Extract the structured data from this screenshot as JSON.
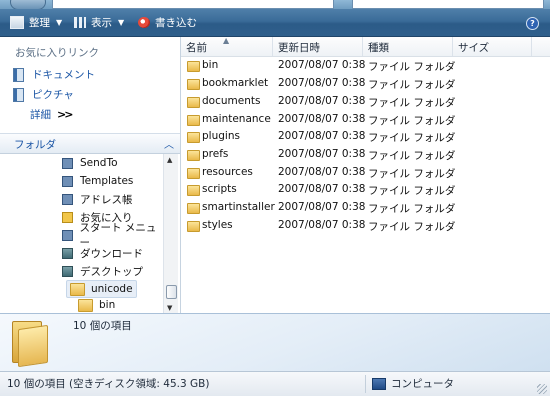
{
  "toolbar": {
    "organize_label": "整理",
    "views_label": "表示",
    "burn_label": "書き込む",
    "help_label": "?"
  },
  "nav": {
    "favorites_title": "お気に入りリンク",
    "favorites": [
      {
        "label": "ドキュメント"
      },
      {
        "label": "ピクチャ"
      }
    ],
    "more_label": "詳細",
    "folders_label": "フォルダ",
    "tree": [
      {
        "label": "SendTo",
        "icon": "shortcut-icon"
      },
      {
        "label": "Templates",
        "icon": "shortcut-icon"
      },
      {
        "label": "アドレス帳",
        "icon": "address-book-icon"
      },
      {
        "label": "お気に入り",
        "icon": "favorites-folder-icon"
      },
      {
        "label": "スタート メニュー",
        "icon": "shortcut-icon"
      },
      {
        "label": "ダウンロード",
        "icon": "downloads-folder-icon"
      },
      {
        "label": "デスクトップ",
        "icon": "desktop-folder-icon"
      },
      {
        "label": "unicode",
        "icon": "folder-icon"
      },
      {
        "label": "bin",
        "icon": "folder-icon"
      }
    ]
  },
  "list": {
    "columns": [
      "名前",
      "更新日時",
      "種類",
      "サイズ"
    ],
    "rows": [
      {
        "name": "bin",
        "date": "2007/08/07 0:38",
        "type": "ファイル フォルダ",
        "size": ""
      },
      {
        "name": "bookmarklet",
        "date": "2007/08/07 0:38",
        "type": "ファイル フォルダ",
        "size": ""
      },
      {
        "name": "documents",
        "date": "2007/08/07 0:38",
        "type": "ファイル フォルダ",
        "size": ""
      },
      {
        "name": "maintenance",
        "date": "2007/08/07 0:38",
        "type": "ファイル フォルダ",
        "size": ""
      },
      {
        "name": "plugins",
        "date": "2007/08/07 0:38",
        "type": "ファイル フォルダ",
        "size": ""
      },
      {
        "name": "prefs",
        "date": "2007/08/07 0:38",
        "type": "ファイル フォルダ",
        "size": ""
      },
      {
        "name": "resources",
        "date": "2007/08/07 0:38",
        "type": "ファイル フォルダ",
        "size": ""
      },
      {
        "name": "scripts",
        "date": "2007/08/07 0:38",
        "type": "ファイル フォルダ",
        "size": ""
      },
      {
        "name": "smartinstaller",
        "date": "2007/08/07 0:38",
        "type": "ファイル フォルダ",
        "size": ""
      },
      {
        "name": "styles",
        "date": "2007/08/07 0:38",
        "type": "ファイル フォルダ",
        "size": ""
      }
    ]
  },
  "details": {
    "count": "10 個の項目"
  },
  "status": {
    "left": "10 個の項目 (空きディスク領域: 45.3 GB)",
    "right": "コンピュータ"
  }
}
